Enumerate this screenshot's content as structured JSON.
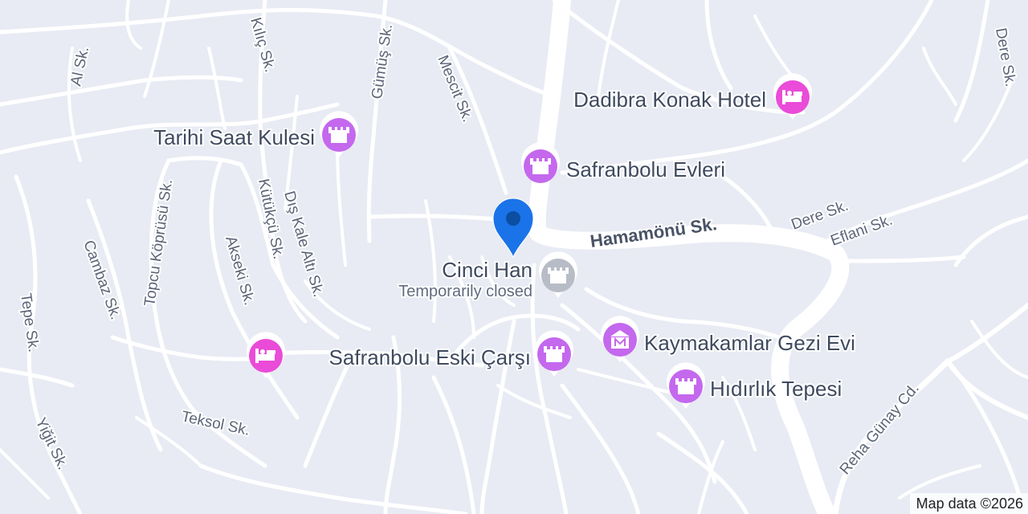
{
  "map": {
    "attribution": "Map data ©2026",
    "colors": {
      "land": "#e8ebf3",
      "road": "#ffffff",
      "attraction": "#c468ee",
      "hotel": "#ea4bd8",
      "closed": "#b7bcc6",
      "pin": "#1a73e8"
    },
    "streets": {
      "al": "Al Sk.",
      "kilic": "Kılıç Sk.",
      "gumus": "Gümüş Sk.",
      "mescit": "Mescit Sk.",
      "dere_top": "Dere Sk.",
      "topcu": "Topcu Köprüsü Sk.",
      "kutukcu": "Kütükçü Sk.",
      "dis_kale": "Dış Kale Altı Sk.",
      "akseki": "Akseki Sk.",
      "cambaz": "Cambaz Sk.",
      "tepe": "Tepe Sk.",
      "hamamonu": "Hamamönü Sk.",
      "dere_mid": "Dere Sk.",
      "eflani": "Eflani Sk.",
      "teksol": "Teksol Sk.",
      "yigit": "Yiğit Sk.",
      "reha": "Reha Günay Cd."
    },
    "places": {
      "dadibra": {
        "name": "Dadibra Konak Hotel",
        "type": "hotel",
        "icon": "hotel-icon"
      },
      "saat_kulesi": {
        "name": "Tarihi Saat Kulesi",
        "type": "attraction",
        "icon": "castle-icon"
      },
      "evleri": {
        "name": "Safranbolu Evleri",
        "type": "attraction",
        "icon": "castle-icon"
      },
      "cinci_han": {
        "name": "Cinci Han",
        "status": "Temporarily closed",
        "type": "attraction-closed",
        "icon": "castle-icon"
      },
      "kaymakamlar": {
        "name": "Kaymakamlar Gezi Evi",
        "type": "museum",
        "icon": "museum-icon"
      },
      "eski_carsi": {
        "name": "Safranbolu Eski Çarşı",
        "type": "attraction",
        "icon": "castle-icon"
      },
      "hidirlik": {
        "name": "Hıdırlık Tepesi",
        "type": "attraction",
        "icon": "castle-icon"
      },
      "hotel_west": {
        "type": "hotel",
        "icon": "hotel-icon"
      }
    }
  }
}
